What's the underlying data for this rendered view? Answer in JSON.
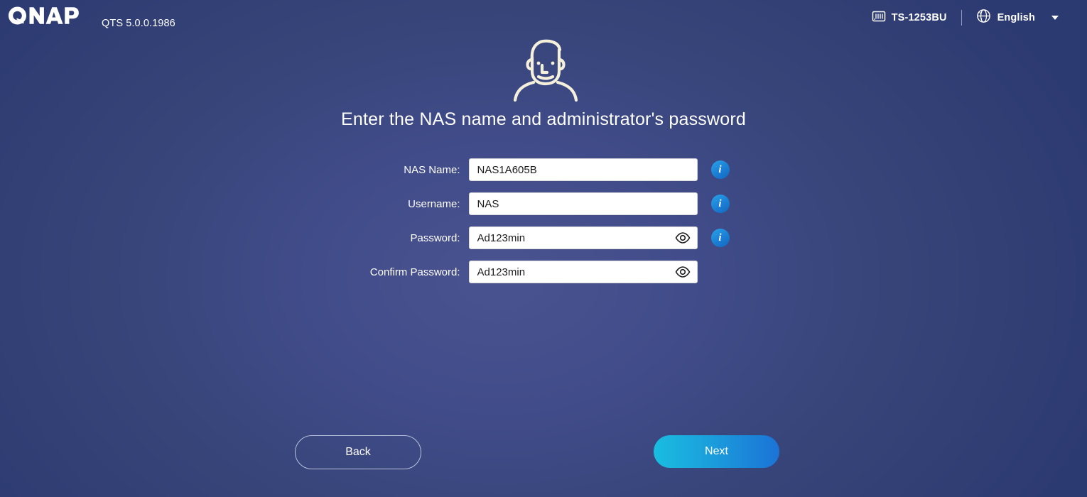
{
  "header": {
    "logo_text": "QNAP",
    "logo_icon": "qnap-logo",
    "version": "QTS 5.0.0.1986",
    "model_icon": "nas-rack-icon",
    "model": "TS-1253BU",
    "globe_icon": "globe-icon",
    "language": "English",
    "caret_icon": "chevron-down-icon"
  },
  "hero": {
    "avatar_icon": "administrator-avatar-icon",
    "title": "Enter the NAS name and administrator's password"
  },
  "form": {
    "fields": [
      {
        "label": "NAS Name:",
        "value": "NAS1A605B",
        "placeholder": "",
        "has_eye": false,
        "has_info": true,
        "name": "nas-name"
      },
      {
        "label": "Username:",
        "value": "NAS",
        "placeholder": "",
        "has_eye": false,
        "has_info": true,
        "name": "username"
      },
      {
        "label": "Password:",
        "value": "Ad123min",
        "placeholder": "",
        "has_eye": true,
        "has_info": true,
        "name": "password"
      },
      {
        "label": "Confirm Password:",
        "value": "Ad123min",
        "placeholder": "",
        "has_eye": true,
        "has_info": false,
        "name": "confirm-password"
      }
    ],
    "info_glyph": "i",
    "eye_icon": "eye-visibility-icon"
  },
  "footer": {
    "back_label": "Back",
    "next_label": "Next"
  },
  "colors": {
    "background_light": "#49538f",
    "background_dark": "#2c3a72",
    "accent_info": "#1b7fd4",
    "next_gradient_start": "#19bde0",
    "next_gradient_end": "#1b73d6",
    "text_primary": "#ffffff",
    "input_text": "#1b1b1b",
    "avatar_stroke": "#f5f0dc"
  }
}
